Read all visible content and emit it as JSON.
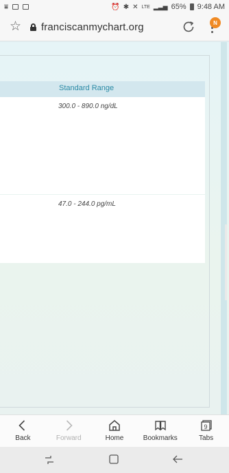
{
  "status_bar": {
    "battery_percent": "65%",
    "time": "9:48 AM",
    "network": "LTE"
  },
  "browser": {
    "url": "franciscanmychart.org",
    "notification_badge": "N",
    "icons": {
      "bookmark_star": "star-outline-icon",
      "lock": "lock-icon",
      "reload": "reload-icon",
      "menu": "more-vert-icon"
    }
  },
  "page": {
    "table": {
      "column_header": "Standard Range",
      "rows": [
        {
          "range": "300.0 - 890.0 ng/dL"
        },
        {
          "range": "47.0 - 244.0 pg/mL"
        }
      ]
    }
  },
  "toolbar": {
    "items": [
      {
        "label": "Back",
        "icon": "chevron-left-icon",
        "enabled": true
      },
      {
        "label": "Forward",
        "icon": "chevron-right-icon",
        "enabled": false
      },
      {
        "label": "Home",
        "icon": "home-icon",
        "enabled": true
      },
      {
        "label": "Bookmarks",
        "icon": "bookmarks-icon",
        "enabled": true
      },
      {
        "label": "Tabs",
        "icon": "tabs-icon",
        "enabled": true,
        "count": "9"
      }
    ]
  },
  "colors": {
    "accent_teal": "#2b8aa5",
    "badge_orange": "#f08a24"
  }
}
